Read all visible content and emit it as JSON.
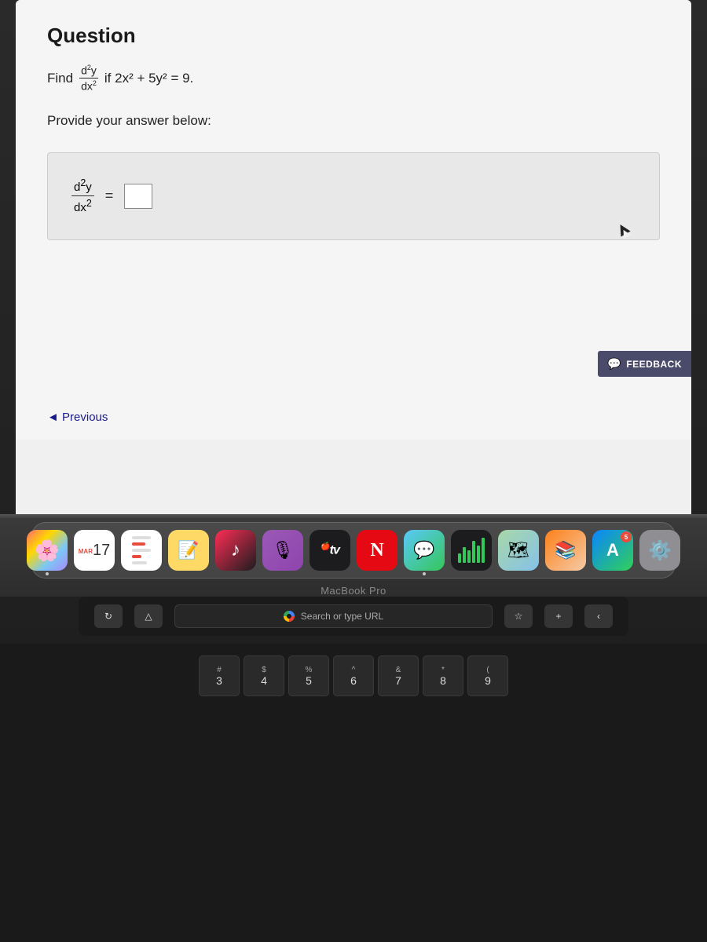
{
  "page": {
    "title": "Question"
  },
  "question": {
    "title": "Question",
    "find_label": "Find",
    "fraction_num": "d²y",
    "fraction_den": "dx²",
    "condition": "if 2x² + 5y² = 9.",
    "provide_text": "Provide your answer below:",
    "answer_fraction_num": "d²y",
    "answer_fraction_den": "dx²",
    "equals": "=",
    "input_placeholder": ""
  },
  "feedback": {
    "label": "FEEDBACK",
    "icon": "💬"
  },
  "navigation": {
    "previous_label": "◄ Previous"
  },
  "dock": {
    "items": [
      {
        "id": "photos",
        "label": "Photos",
        "icon": "🌸"
      },
      {
        "id": "calendar",
        "label": "Calendar",
        "month": "MAR",
        "day": "17"
      },
      {
        "id": "reminders",
        "label": "Reminders",
        "icon": "⚪"
      },
      {
        "id": "notes",
        "label": "Notes",
        "icon": "📝"
      },
      {
        "id": "music",
        "label": "Music",
        "icon": "♪"
      },
      {
        "id": "podcasts",
        "label": "Podcasts",
        "icon": "🎙"
      },
      {
        "id": "appletv",
        "label": "TV",
        "text": "tv"
      },
      {
        "id": "netflix",
        "label": "Netflix",
        "text": "N"
      },
      {
        "id": "messages",
        "label": "Messages",
        "icon": "💬"
      },
      {
        "id": "stocks",
        "label": "Stocks"
      },
      {
        "id": "maps",
        "label": "Maps",
        "icon": "🗺"
      },
      {
        "id": "ibooks",
        "label": "Books",
        "icon": "📚"
      },
      {
        "id": "appstore",
        "label": "App Store",
        "icon": "🅰"
      },
      {
        "id": "systemprefs",
        "label": "System Preferences",
        "icon": "⚙"
      }
    ],
    "macbook_label": "MacBook Pro"
  },
  "touchbar": {
    "search_placeholder": "Search or type URL",
    "search_icon": "G"
  },
  "keyboard": {
    "row1": [
      {
        "top": "#",
        "bottom": "3"
      },
      {
        "top": "$",
        "bottom": "4"
      },
      {
        "top": "%",
        "bottom": "5"
      },
      {
        "top": "^",
        "bottom": "6"
      },
      {
        "top": "&",
        "bottom": "7"
      },
      {
        "top": "*",
        "bottom": "8"
      },
      {
        "top": "(",
        "bottom": "9"
      }
    ]
  }
}
